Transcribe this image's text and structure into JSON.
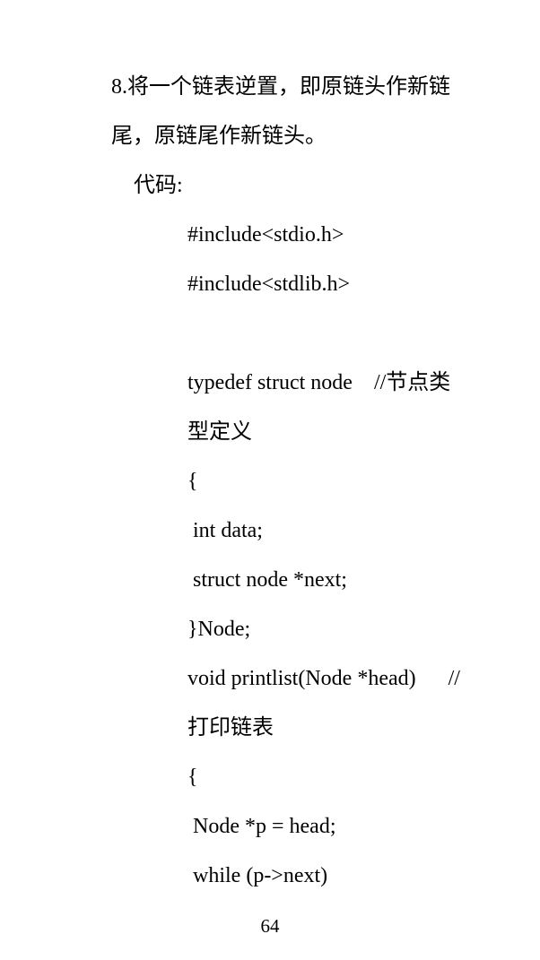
{
  "problem": {
    "line1": "8.将一个链表逆置，即原链头作新链",
    "line2": "尾，原链尾作新链头。"
  },
  "code_label": "代码:",
  "code": [
    "#include<stdio.h>",
    "#include<stdlib.h>",
    "",
    "typedef struct node    //节点类",
    "型定义",
    "{",
    " int data;",
    " struct node *next;",
    "}Node;",
    "void printlist(Node *head)      //",
    "打印链表",
    "{",
    " Node *p = head;",
    " while (p->next)"
  ],
  "page_number": "64"
}
